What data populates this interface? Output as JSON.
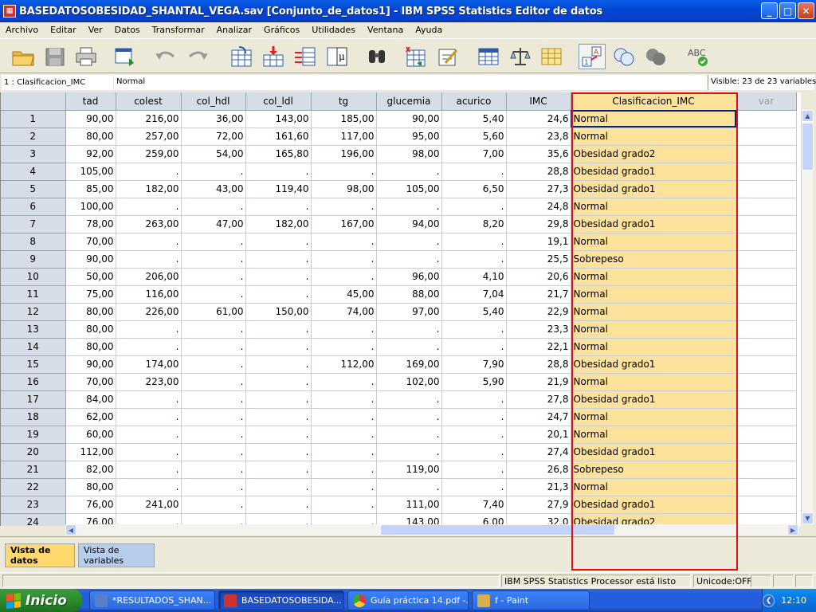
{
  "window": {
    "title": "BASEDATOSOBESIDAD_SHANTAL_VEGA.sav [Conjunto_de_datos1] - IBM SPSS Statistics Editor de datos",
    "minimize": "_",
    "maximize": "□",
    "close": "✕"
  },
  "menu": [
    "Archivo",
    "Editar",
    "Ver",
    "Datos",
    "Transformar",
    "Analizar",
    "Gráficos",
    "Utilidades",
    "Ventana",
    "Ayuda"
  ],
  "cell_editor": {
    "reference": "1 : Clasificacion_IMC",
    "value": "Normal",
    "visible": "Visible: 23 de 23 variables"
  },
  "grid": {
    "columns": [
      "tad",
      "colest",
      "col_hdl",
      "col_ldl",
      "tg",
      "glucemia",
      "acurico",
      "IMC",
      "Clasificacion_IMC",
      "var"
    ],
    "rows": [
      [
        "1",
        "90,00",
        "216,00",
        "36,00",
        "143,00",
        "185,00",
        "90,00",
        "5,40",
        "24,6",
        "Normal"
      ],
      [
        "2",
        "80,00",
        "257,00",
        "72,00",
        "161,60",
        "117,00",
        "95,00",
        "5,60",
        "23,8",
        "Normal"
      ],
      [
        "3",
        "92,00",
        "259,00",
        "54,00",
        "165,80",
        "196,00",
        "98,00",
        "7,00",
        "35,6",
        "Obesidad grado2"
      ],
      [
        "4",
        "105,00",
        ".",
        ".",
        ".",
        ".",
        ".",
        ".",
        "28,8",
        "Obesidad grado1"
      ],
      [
        "5",
        "85,00",
        "182,00",
        "43,00",
        "119,40",
        "98,00",
        "105,00",
        "6,50",
        "27,3",
        "Obesidad grado1"
      ],
      [
        "6",
        "100,00",
        ".",
        ".",
        ".",
        ".",
        ".",
        ".",
        "24,8",
        "Normal"
      ],
      [
        "7",
        "78,00",
        "263,00",
        "47,00",
        "182,00",
        "167,00",
        "94,00",
        "8,20",
        "29,8",
        "Obesidad grado1"
      ],
      [
        "8",
        "70,00",
        ".",
        ".",
        ".",
        ".",
        ".",
        ".",
        "19,1",
        "Normal"
      ],
      [
        "9",
        "90,00",
        ".",
        ".",
        ".",
        ".",
        ".",
        ".",
        "25,5",
        "Sobrepeso"
      ],
      [
        "10",
        "50,00",
        "206,00",
        ".",
        ".",
        ".",
        "96,00",
        "4,10",
        "20,6",
        "Normal"
      ],
      [
        "11",
        "75,00",
        "116,00",
        ".",
        ".",
        "45,00",
        "88,00",
        "7,04",
        "21,7",
        "Normal"
      ],
      [
        "12",
        "80,00",
        "226,00",
        "61,00",
        "150,00",
        "74,00",
        "97,00",
        "5,40",
        "22,9",
        "Normal"
      ],
      [
        "13",
        "80,00",
        ".",
        ".",
        ".",
        ".",
        ".",
        ".",
        "23,3",
        "Normal"
      ],
      [
        "14",
        "80,00",
        ".",
        ".",
        ".",
        ".",
        ".",
        ".",
        "22,1",
        "Normal"
      ],
      [
        "15",
        "90,00",
        "174,00",
        ".",
        ".",
        "112,00",
        "169,00",
        "7,90",
        "28,8",
        "Obesidad grado1"
      ],
      [
        "16",
        "70,00",
        "223,00",
        ".",
        ".",
        ".",
        "102,00",
        "5,90",
        "21,9",
        "Normal"
      ],
      [
        "17",
        "84,00",
        ".",
        ".",
        ".",
        ".",
        ".",
        ".",
        "27,8",
        "Obesidad grado1"
      ],
      [
        "18",
        "62,00",
        ".",
        ".",
        ".",
        ".",
        ".",
        ".",
        "24,7",
        "Normal"
      ],
      [
        "19",
        "60,00",
        ".",
        ".",
        ".",
        ".",
        ".",
        ".",
        "20,1",
        "Normal"
      ],
      [
        "20",
        "112,00",
        ".",
        ".",
        ".",
        ".",
        ".",
        ".",
        "27,4",
        "Obesidad grado1"
      ],
      [
        "21",
        "82,00",
        ".",
        ".",
        ".",
        ".",
        "119,00",
        ".",
        "26,8",
        "Sobrepeso"
      ],
      [
        "22",
        "80,00",
        ".",
        ".",
        ".",
        ".",
        ".",
        ".",
        "21,3",
        "Normal"
      ],
      [
        "23",
        "76,00",
        "241,00",
        ".",
        ".",
        ".",
        "111,00",
        "7,40",
        "27,9",
        "Obesidad grado1"
      ],
      [
        "24",
        "76,00",
        ".",
        ".",
        ".",
        ".",
        "143,00",
        "6,00",
        "32,0",
        "Obesidad grado2"
      ]
    ]
  },
  "tabs": {
    "data_view": "Vista de datos",
    "variable_view": "Vista de variables"
  },
  "status": {
    "processor": "IBM SPSS Statistics Processor está listo",
    "unicode": "Unicode:OFF"
  },
  "taskbar": {
    "start": "Inicio",
    "tasks": [
      "*RESULTADOS_SHAN...",
      "BASEDATOSOBESIDA...",
      "Guía práctica 14.pdf -...",
      "f - Paint"
    ],
    "clock": "12:10"
  },
  "colors": {
    "highlight_column": "#FCE29A",
    "annotation_box": "#E01010",
    "active_tab": "#FDD96D"
  }
}
